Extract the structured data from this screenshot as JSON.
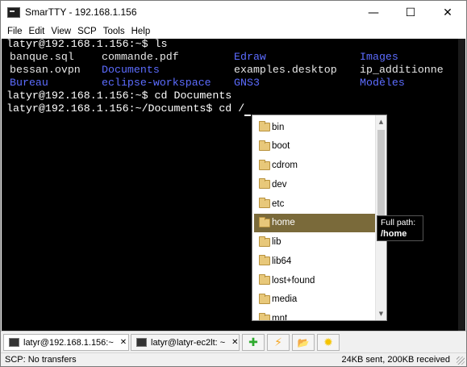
{
  "window": {
    "title": "SmarTTY - 192.168.1.156",
    "controls": {
      "minimize": "—",
      "maximize": "☐",
      "close": "✕"
    }
  },
  "menu": [
    "File",
    "Edit",
    "View",
    "SCP",
    "Tools",
    "Help"
  ],
  "terminal": {
    "lines": [
      "latyr@192.168.1.156:~$ ls",
      "latyr@192.168.1.156:~$ cd Documents",
      "latyr@192.168.1.156:~/Documents$ cd /"
    ],
    "ls_output": [
      [
        "banque.sql",
        "commande.pdf",
        "Edraw",
        "Images"
      ],
      [
        "bessan.ovpn",
        "Documents",
        "examples.desktop",
        "ip_additionne"
      ],
      [
        "Bureau",
        "eclipse-workspace",
        "GNS3",
        "Modèles"
      ]
    ],
    "ls_colors": [
      [
        "white",
        "white",
        "blue",
        "blue"
      ],
      [
        "white",
        "blue",
        "white",
        "white"
      ],
      [
        "blue",
        "blue",
        "blue",
        "blue"
      ]
    ]
  },
  "autocomplete": {
    "items": [
      "bin",
      "boot",
      "cdrom",
      "dev",
      "etc",
      "home",
      "lib",
      "lib64",
      "lost+found",
      "media",
      "mnt"
    ],
    "selected": "home",
    "scroll_up": "▲",
    "scroll_down": "▼"
  },
  "tooltip": {
    "label": "Full path:",
    "value": "/home"
  },
  "tabs": [
    {
      "label": "latyr@192.168.1.156:~",
      "close": "✕",
      "active": true
    },
    {
      "label": "latyr@latyr-ec2lt: ~",
      "close": "✕",
      "active": false
    }
  ],
  "toolbar_icons": {
    "add": "✚",
    "lightning": "⚡",
    "folder": "📂",
    "settings": "✹"
  },
  "status": {
    "left": "SCP: No transfers",
    "right": "24KB sent, 200KB received"
  },
  "colors": {
    "selection": "#7a6a3a",
    "dir_blue": "#5c6cff",
    "terminal_bg": "#000000",
    "add_green": "#2eaa2e",
    "lightning": "#f5a623",
    "gear": "#f5c400"
  }
}
